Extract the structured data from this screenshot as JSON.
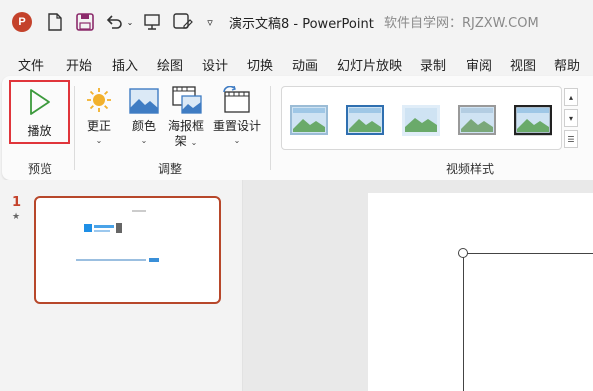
{
  "titlebar": {
    "app_icon": "powerpoint-logo",
    "app_letter": "P",
    "quick_access": [
      "new-file-icon",
      "save-icon",
      "undo-icon",
      "present-from-start-icon",
      "save-as-icon",
      "customize-dropdown-icon"
    ],
    "document_title": "演示文稿8  -  PowerPoint",
    "watermark": "软件自学网：RJZXW.COM"
  },
  "menu": {
    "items": [
      "文件",
      "开始",
      "插入",
      "绘图",
      "设计",
      "切换",
      "动画",
      "幻灯片放映",
      "录制",
      "审阅",
      "视图",
      "帮助"
    ]
  },
  "ribbon": {
    "preview_group": {
      "label": "预览",
      "play_label": "播放"
    },
    "adjust_group": {
      "label": "调整",
      "buttons": [
        {
          "label": "更正",
          "icon": "brightness-sun-icon"
        },
        {
          "label": "颜色",
          "icon": "picture-color-icon"
        },
        {
          "label": "海报框",
          "label2": "架",
          "icon": "poster-frame-icon"
        },
        {
          "label": "重置设计",
          "icon": "reset-design-icon"
        }
      ]
    },
    "video_styles_group": {
      "label": "视频样式",
      "style_count": 5
    }
  },
  "slides_pane": {
    "slide_number": "1",
    "slide_marker": "★"
  },
  "colors": {
    "accent": "#c4422b",
    "highlight_box": "#e0353b",
    "play_green": "#3c9a3c"
  }
}
